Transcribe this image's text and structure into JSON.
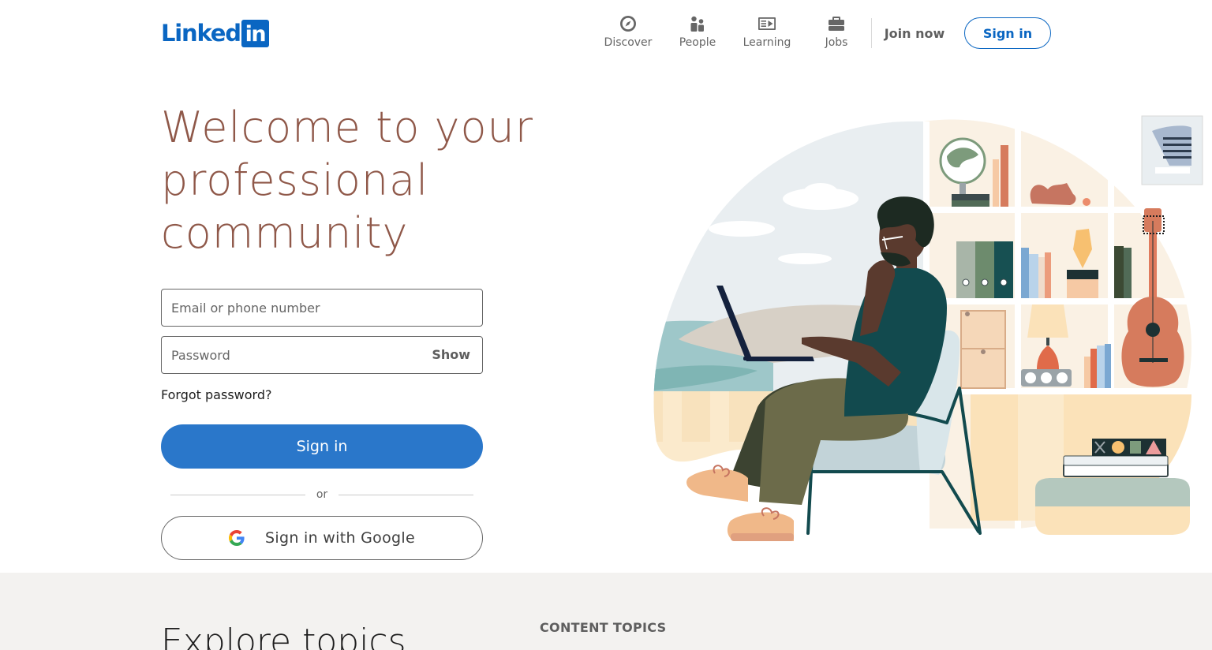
{
  "header": {
    "logo_word": "Linked",
    "logo_box": "in",
    "nav": [
      {
        "label": "Discover",
        "icon": "compass-icon"
      },
      {
        "label": "People",
        "icon": "people-icon"
      },
      {
        "label": "Learning",
        "icon": "learning-icon"
      },
      {
        "label": "Jobs",
        "icon": "briefcase-icon"
      }
    ],
    "join_now": "Join now",
    "sign_in": "Sign in"
  },
  "hero": {
    "title": "Welcome to your professional community"
  },
  "login": {
    "email_placeholder": "Email or phone number",
    "password_placeholder": "Password",
    "show": "Show",
    "forgot": "Forgot password?",
    "sign_in": "Sign in",
    "or": "or",
    "google": "Sign in with Google"
  },
  "explore": {
    "title": "Explore topics",
    "topics_label": "CONTENT TOPICS"
  },
  "colors": {
    "brand": "#0a66c2",
    "primary_button": "#2a77ca",
    "hero_title": "#8f5849",
    "lower_bg": "#f3f2f0"
  }
}
